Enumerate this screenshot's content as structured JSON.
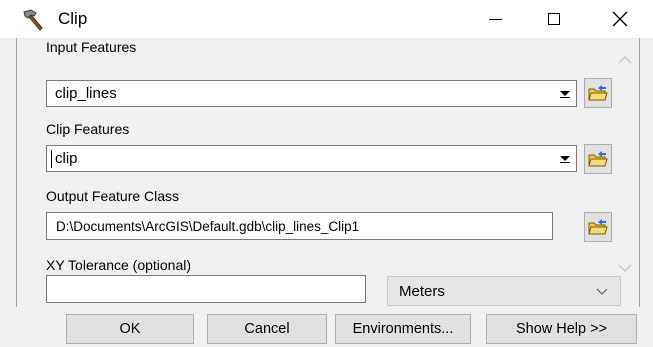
{
  "window": {
    "title": "Clip",
    "title_icon": "hammer-icon"
  },
  "form": {
    "input_features": {
      "label": "Input Features",
      "value": "clip_lines"
    },
    "clip_features": {
      "label": "Clip Features",
      "value": "clip"
    },
    "output_feature_class": {
      "label": "Output Feature Class",
      "value": "D:\\Documents\\ArcGIS\\Default.gdb\\clip_lines_Clip1"
    },
    "xy_tolerance": {
      "label": "XY Tolerance (optional)",
      "value": "",
      "unit": "Meters"
    }
  },
  "buttons": {
    "ok": "OK",
    "cancel": "Cancel",
    "environments": "Environments...",
    "show_help": "Show Help >>"
  }
}
